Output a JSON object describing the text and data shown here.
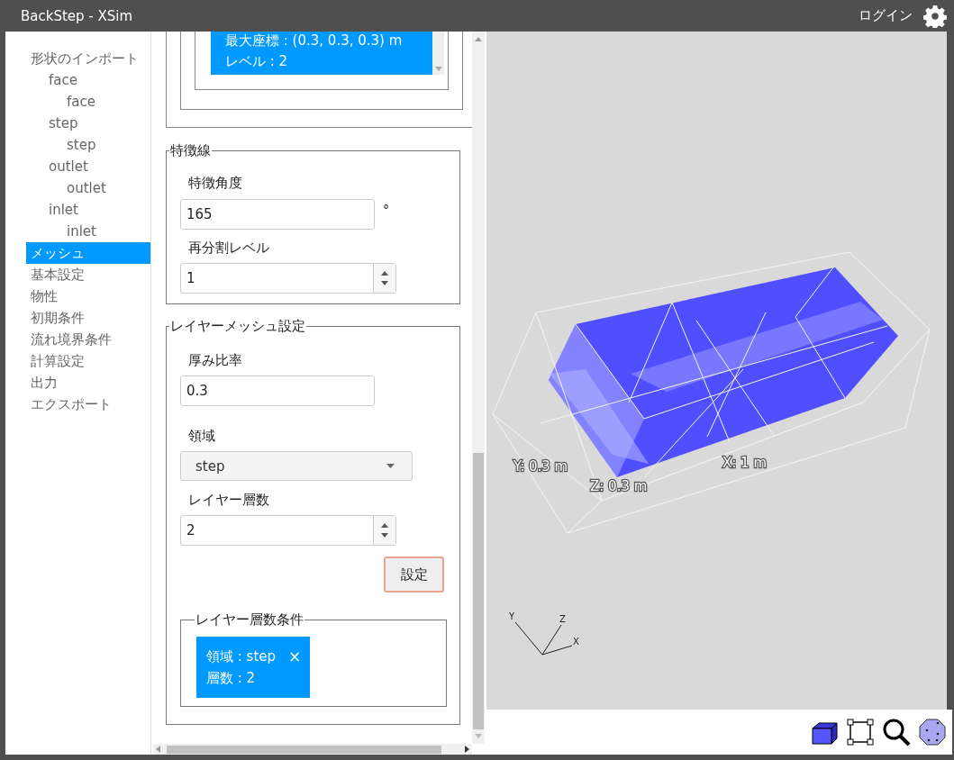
{
  "window": {
    "title": "BackStep - XSim",
    "login": "ログイン"
  },
  "sidebar": {
    "items": [
      {
        "label": "形状のインポート",
        "selected": false,
        "children": [
          {
            "label": "face",
            "selected": false,
            "children": [
              {
                "label": "face",
                "selected": false
              }
            ]
          },
          {
            "label": "step",
            "selected": false,
            "children": [
              {
                "label": "step",
                "selected": false
              }
            ]
          },
          {
            "label": "outlet",
            "selected": false,
            "children": [
              {
                "label": "outlet",
                "selected": false
              }
            ]
          },
          {
            "label": "inlet",
            "selected": false,
            "children": [
              {
                "label": "inlet",
                "selected": false
              }
            ]
          }
        ]
      },
      {
        "label": "メッシュ",
        "selected": true
      },
      {
        "label": "基本設定",
        "selected": false
      },
      {
        "label": "物性",
        "selected": false
      },
      {
        "label": "初期条件",
        "selected": false
      },
      {
        "label": "流れ境界条件",
        "selected": false
      },
      {
        "label": "計算設定",
        "selected": false
      },
      {
        "label": "出力",
        "selected": false
      },
      {
        "label": "エクスポート",
        "selected": false
      }
    ]
  },
  "refine_box": {
    "lines": [
      "最大座標 : (0.3, 0.3, 0.3) m",
      "レベル : 2"
    ]
  },
  "feature_lines": {
    "legend": "特徴線",
    "angle_label": "特徴角度",
    "angle_value": "165",
    "angle_unit": "°",
    "level_label": "再分割レベル",
    "level_value": "1"
  },
  "layer_mesh": {
    "legend": "レイヤーメッシュ設定",
    "ratio_label": "厚み比率",
    "ratio_value": "0.3",
    "region_label": "領域",
    "region_value": "step",
    "layers_label": "レイヤー層数",
    "layers_value": "2",
    "set_button": "設定",
    "conditions": {
      "legend": "レイヤー層数条件",
      "items": [
        {
          "lines": [
            "領域 : step",
            "層数 : 2"
          ],
          "remove": "×"
        }
      ]
    }
  },
  "viewport": {
    "dimension_labels": [
      "Y: 0.3 m",
      "Z: 0.3 m",
      "X: 1 m"
    ],
    "axes": [
      "Y",
      "Z",
      "X"
    ]
  }
}
